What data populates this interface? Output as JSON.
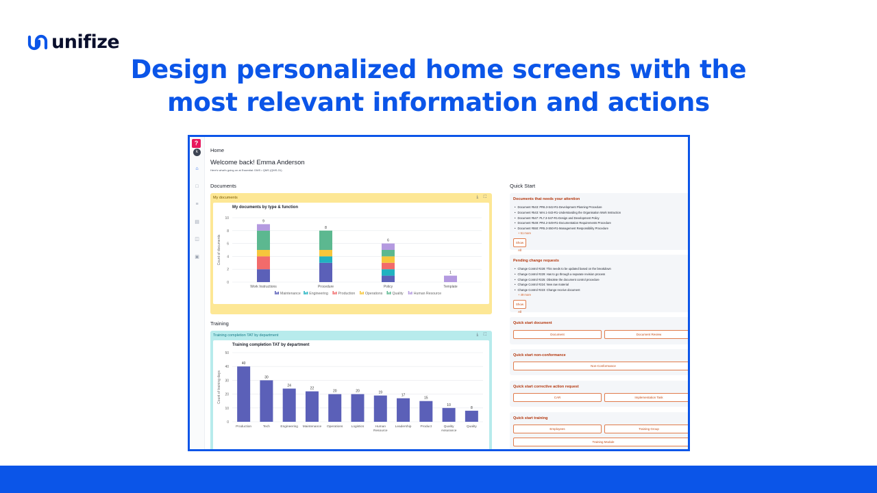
{
  "brand": {
    "name": "unifize",
    "accent": "#0b55e8"
  },
  "headline": {
    "line1": "Design personalized home screens with the",
    "line2": "most relevant information and actions"
  },
  "app": {
    "help_label": "?",
    "avatar_initial": "k",
    "rail_icons": [
      "home-icon",
      "chat-icon",
      "list-icon",
      "report-icon",
      "contacts-icon",
      "settings-icon"
    ],
    "page_title": "Home",
    "welcome": "Welcome back! Emma Anderson",
    "subinfo": "Here's what's going on at Essential: DMS • QMS (QMS-31)",
    "documents_section": "Documents",
    "training_section": "Training",
    "quick_start_section": "Quick Start",
    "documents_panel": {
      "header": "My documents",
      "chart_title": "My documents by type & function",
      "tools": "⤓ ⛶",
      "legend": [
        "Maintenance",
        "Engineering",
        "Production",
        "Operations",
        "Quality",
        "Human Resource"
      ]
    },
    "training_panel": {
      "header": "Training completion TAT by department",
      "chart_title": "Training completion TAT by department",
      "tools": "⤓ ⛶"
    },
    "attention": {
      "title": "Documents that needs your attention",
      "items": [
        "Document #543: PR6.3-S42-R1-Development Planning Procedure",
        "Document #543: WAI.1-S43-R1-Understanding the Organisation Work Instruction",
        "Document #547: PL7.3-S47-R1-Design and Development Policy",
        "Document #549: PR4.2-S49-R1-Documentation Requirements Procedure",
        "Document #550: PR5.3-S50-R1-Management Responsibility Procedure"
      ],
      "more": "+ 51 more",
      "show_all": "Show All"
    },
    "pending": {
      "title": "Pending change requests",
      "items": [
        "Change Control #228: This needs to be updated based on the breakdown",
        "Change Control #229: Has to go through a separate revision process",
        "Change Control #225: Obsolete the document control procedure",
        "Change Control #224: New raw material",
        "Change Control #223: Change receive document"
      ],
      "more": "+ 49 more",
      "show_all": "Show All"
    },
    "qs_document": {
      "title": "Quick start document",
      "buttons": [
        "Document",
        "Document Review"
      ]
    },
    "qs_nonconformance": {
      "title": "Quick start non-conformance",
      "buttons": [
        "Non-Conformance"
      ]
    },
    "qs_capa": {
      "title": "Quick start corrective action request",
      "buttons": [
        "CAR",
        "Implementation Task"
      ]
    },
    "qs_training": {
      "title": "Quick start training",
      "buttons": [
        "Employees",
        "Training Group",
        "Training Module"
      ]
    }
  },
  "colors": {
    "documents_panel_bg": "#fde795",
    "training_panel_bg": "#b7ebec",
    "training_header_text": "#167a86",
    "bar_primary": "#5b60b8"
  },
  "chart_data": [
    {
      "type": "bar",
      "stacked": true,
      "title": "My documents by type & function",
      "ylabel": "Count of documents",
      "categories": [
        "Work Instructions",
        "Procedure",
        "Policy",
        "Template"
      ],
      "ylim": [
        0,
        10
      ],
      "yticks": [
        0,
        2,
        4,
        6,
        8,
        10
      ],
      "totals": [
        9,
        8,
        6,
        1
      ],
      "series": [
        {
          "name": "Maintenance",
          "color": "#5b60b8",
          "values": [
            2,
            3,
            1,
            0
          ]
        },
        {
          "name": "Engineering",
          "color": "#20b2c0",
          "values": [
            0,
            1,
            1,
            0
          ]
        },
        {
          "name": "Production",
          "color": "#f26b6b",
          "values": [
            2,
            0,
            1,
            0
          ]
        },
        {
          "name": "Operations",
          "color": "#f6c63c",
          "values": [
            1,
            1,
            1,
            0
          ]
        },
        {
          "name": "Quality",
          "color": "#5cb890",
          "values": [
            3,
            3,
            1,
            0
          ]
        },
        {
          "name": "Human Resource",
          "color": "#b49ae0",
          "values": [
            1,
            0,
            1,
            1
          ]
        }
      ],
      "legend_position": "bottom",
      "grid": true
    },
    {
      "type": "bar",
      "title": "Training completion TAT by department",
      "ylabel": "Count of training days",
      "categories": [
        "Production",
        "Tech",
        "Engineering",
        "Maintenance",
        "Operations",
        "Logistics",
        "Human Resource",
        "Leadership",
        "Product",
        "Quality Assurance",
        "Quality"
      ],
      "values": [
        40,
        30,
        24,
        22,
        20,
        20,
        19,
        17,
        15,
        10,
        8
      ],
      "ylim": [
        0,
        50
      ],
      "yticks": [
        0,
        10,
        20,
        30,
        40,
        50
      ],
      "color": "#5b60b8",
      "grid": true
    }
  ]
}
